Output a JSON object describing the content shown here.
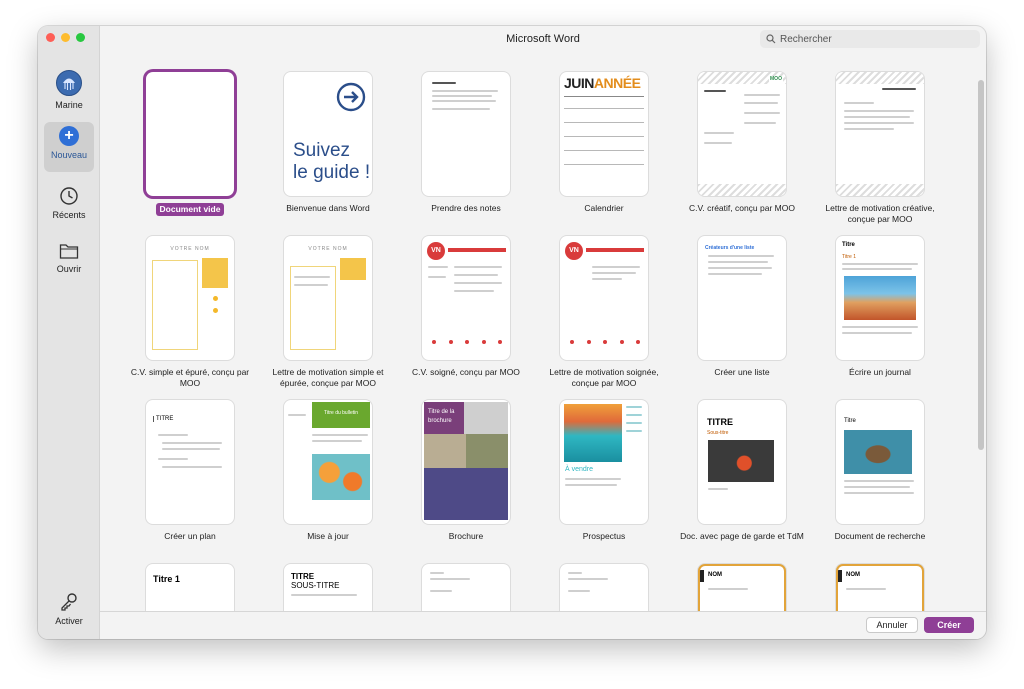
{
  "window": {
    "title": "Microsoft Word"
  },
  "search": {
    "placeholder": "Rechercher"
  },
  "sidebar": {
    "items": [
      {
        "label": "Marine"
      },
      {
        "label": "Nouveau"
      },
      {
        "label": "Récents"
      },
      {
        "label": "Ouvrir"
      },
      {
        "label": "Activer"
      }
    ]
  },
  "templates": [
    {
      "label": "Document vide"
    },
    {
      "label": "Bienvenue dans Word"
    },
    {
      "label": "Prendre des notes"
    },
    {
      "label": "Calendrier"
    },
    {
      "label": "C.V. créatif, conçu par MOO"
    },
    {
      "label": "Lettre de motivation créative, conçue par MOO"
    },
    {
      "label": "C.V. simple et épuré, conçu par MOO"
    },
    {
      "label": "Lettre de motivation simple et épurée, conçue par MOO"
    },
    {
      "label": "C.V. soigné, conçu par MOO"
    },
    {
      "label": "Lettre de motivation soignée, conçue par MOO"
    },
    {
      "label": "Créer une liste"
    },
    {
      "label": "Écrire un journal"
    },
    {
      "label": "Créer un plan"
    },
    {
      "label": "Mise à jour"
    },
    {
      "label": "Brochure"
    },
    {
      "label": "Prospectus"
    },
    {
      "label": "Doc. avec page de garde et TdM"
    },
    {
      "label": "Document de recherche"
    }
  ],
  "thumbs": {
    "welcome": {
      "line1": "Suivez",
      "line2": "le guide !"
    },
    "calendar": {
      "month": "JUIN",
      "year": "ANNÉE"
    },
    "moo_name": "VOTRE NOM",
    "vn": "VN",
    "list_title": "Créateurs d'une liste",
    "journal_title": "Titre",
    "journal_sub": "Titre 1",
    "plan_title": "TITRE",
    "newsletter_title": "Titre du bulletin",
    "brochure_title": "Titre de la brochure",
    "prospectus_title": "À vendre",
    "cover_title": "TITRE",
    "cover_sub": "Sous-titre",
    "research_title": "Titre",
    "row4_a": "Titre 1",
    "row4_b1": "TITRE",
    "row4_b2": "SOUS-TITRE",
    "row4_e": "NOM",
    "row4_f": "NOM"
  },
  "footer": {
    "cancel": "Annuler",
    "create": "Créer"
  },
  "colors": {
    "accent": "#8f3f96",
    "blue": "#2f6fd6",
    "welcome_blue": "#2b4e8a"
  }
}
